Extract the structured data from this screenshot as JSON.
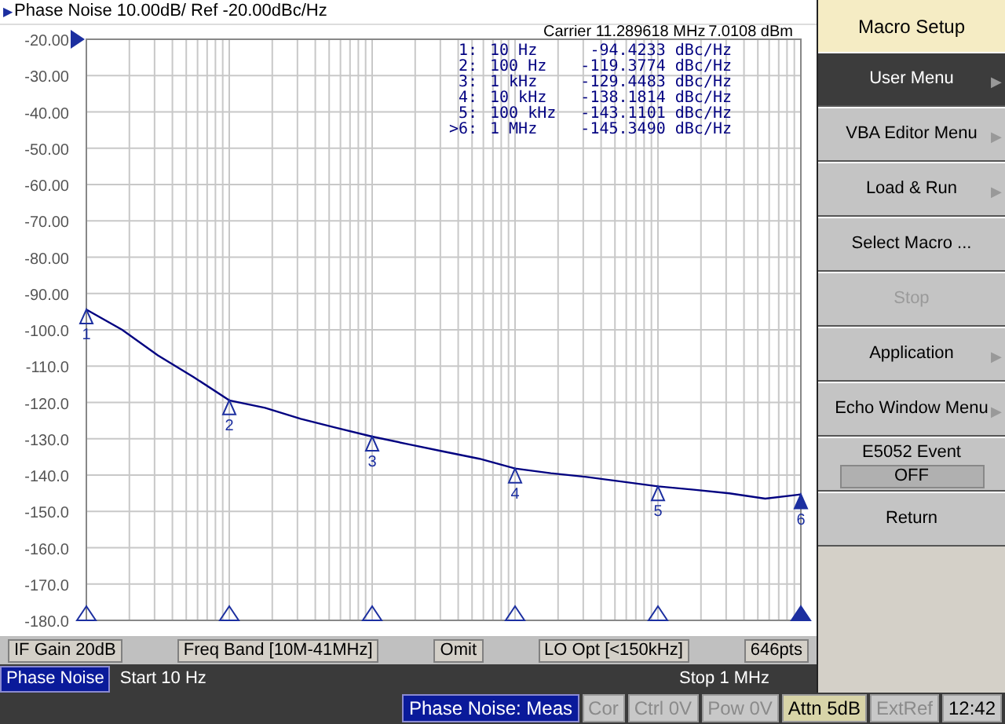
{
  "trace_title_icon": "▶",
  "trace_title": "Phase Noise 10.00dB/ Ref -20.00dBc/Hz",
  "carrier": {
    "label": "Carrier 11.289618 MHz",
    "power": "7.0108 dBm"
  },
  "markers": [
    {
      "num": "1:",
      "freq": "10 Hz",
      "value": "-94.4233 dBc/Hz",
      "label": "1",
      "active": false
    },
    {
      "num": "2:",
      "freq": "100 Hz",
      "value": "-119.3774 dBc/Hz",
      "label": "2",
      "active": false
    },
    {
      "num": "3:",
      "freq": "1 kHz",
      "value": "-129.4483 dBc/Hz",
      "label": "3",
      "active": false
    },
    {
      "num": "4:",
      "freq": "10 kHz",
      "value": "-138.1814 dBc/Hz",
      "label": "4",
      "active": false
    },
    {
      "num": "5:",
      "freq": "100 kHz",
      "value": "-143.1101 dBc/Hz",
      "label": "5",
      "active": false
    },
    {
      "num": ">6:",
      "freq": "1 MHz",
      "value": "-145.3490 dBc/Hz",
      "label": "6",
      "active": true
    }
  ],
  "chart_data": {
    "type": "line",
    "grid": true,
    "ylim": [
      -180,
      -20
    ],
    "yticks": [
      {
        "value": -20,
        "label": "-20.00"
      },
      {
        "value": -30,
        "label": "-30.00"
      },
      {
        "value": -40,
        "label": "-40.00"
      },
      {
        "value": -50,
        "label": "-50.00"
      },
      {
        "value": -60,
        "label": "-60.00"
      },
      {
        "value": -70,
        "label": "-70.00"
      },
      {
        "value": -80,
        "label": "-80.00"
      },
      {
        "value": -90,
        "label": "-90.00"
      },
      {
        "value": -100,
        "label": "-100.0"
      },
      {
        "value": -110,
        "label": "-110.0"
      },
      {
        "value": -120,
        "label": "-120.0"
      },
      {
        "value": -130,
        "label": "-130.0"
      },
      {
        "value": -140,
        "label": "-140.0"
      },
      {
        "value": -150,
        "label": "-150.0"
      },
      {
        "value": -160,
        "label": "-160.0"
      },
      {
        "value": -170,
        "label": "-170.0"
      },
      {
        "value": -180,
        "label": "-180.0"
      }
    ],
    "categories": [
      null,
      null,
      null,
      null,
      null,
      null,
      null,
      null,
      null,
      null,
      null,
      null,
      null,
      null,
      null,
      null,
      null,
      null,
      null,
      null,
      null
    ],
    "series": [
      {
        "color": "#000080",
        "values": [
          -94.4,
          -100,
          -107,
          -113,
          -119.4,
          -121.5,
          -124.5,
          -127,
          -129.4,
          -131.5,
          -133.5,
          -135.5,
          -138.2,
          -139.5,
          -140.5,
          -141.8,
          -143.1,
          -144,
          -145,
          -146.5,
          -145.3
        ]
      }
    ]
  },
  "status_fields": [
    "IF Gain 20dB",
    "Freq Band [10M-41MHz]",
    "Omit",
    "LO Opt [<150kHz]",
    "646pts"
  ],
  "channel_bar": {
    "trace": "Phase Noise",
    "start": "Start 10 Hz",
    "stop": "Stop 1 MHz"
  },
  "status_bar": [
    {
      "text": "Phase Noise: Meas",
      "kind": "active"
    },
    {
      "text": "Cor",
      "kind": "dim"
    },
    {
      "text": "Ctrl 0V",
      "kind": "dim"
    },
    {
      "text": "Pow 0V",
      "kind": "dim"
    },
    {
      "text": "Attn 5dB",
      "kind": "lit"
    },
    {
      "text": "ExtRef",
      "kind": "dim"
    },
    {
      "text": "12:42",
      "kind": "time"
    }
  ],
  "softkey_panel": {
    "title": "Macro Setup",
    "keys": [
      {
        "label": "User Menu",
        "selected": true,
        "disabled": false,
        "arrow": "▶"
      },
      {
        "label": "VBA Editor Menu",
        "selected": false,
        "disabled": false,
        "arrow": "▶"
      },
      {
        "label": "Load & Run",
        "selected": false,
        "disabled": false,
        "arrow": "▶"
      },
      {
        "label": "Select Macro ...",
        "selected": false,
        "disabled": false
      },
      {
        "label": "Stop",
        "selected": false,
        "disabled": true
      },
      {
        "label": "Application",
        "selected": false,
        "disabled": false,
        "arrow": "▶"
      },
      {
        "label": "Echo Window Menu",
        "selected": false,
        "disabled": false,
        "arrow": "▶"
      },
      {
        "label": "E5052 Event",
        "selected": false,
        "disabled": false,
        "value": "OFF"
      },
      {
        "label": "Return",
        "selected": false,
        "disabled": false
      }
    ]
  }
}
